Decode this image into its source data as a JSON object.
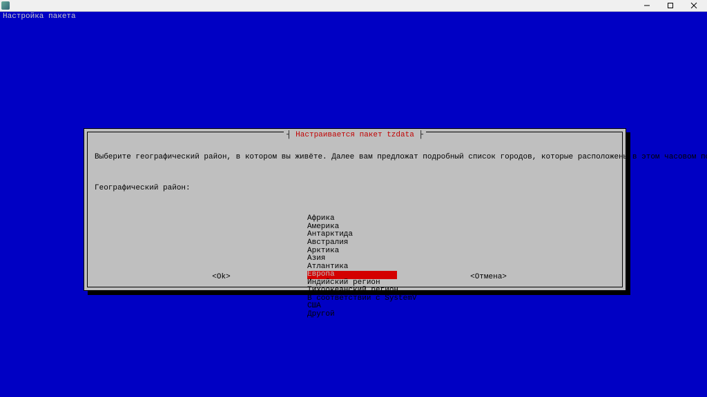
{
  "window": {
    "title": ""
  },
  "terminal": {
    "header": "Настройка пакета"
  },
  "dialog": {
    "title": "Настраивается пакет tzdata",
    "prompt": "Выберите географический район, в котором вы живёте. Далее вам предложат подробный список городов, которые расположены в этом часовом поясе.",
    "field_label": "Географический район:",
    "options": [
      "Африка",
      "Америка",
      "Антарктида",
      "Австралия",
      "Арктика",
      "Азия",
      "Атлантика",
      "Европа",
      "Индийский регион",
      "Тихоокеанский регион",
      "В соответствии с SystemV",
      "США",
      "Другой"
    ],
    "selected_index": 7,
    "ok_label": "<Ok>",
    "cancel_label": "<Отмена>"
  }
}
